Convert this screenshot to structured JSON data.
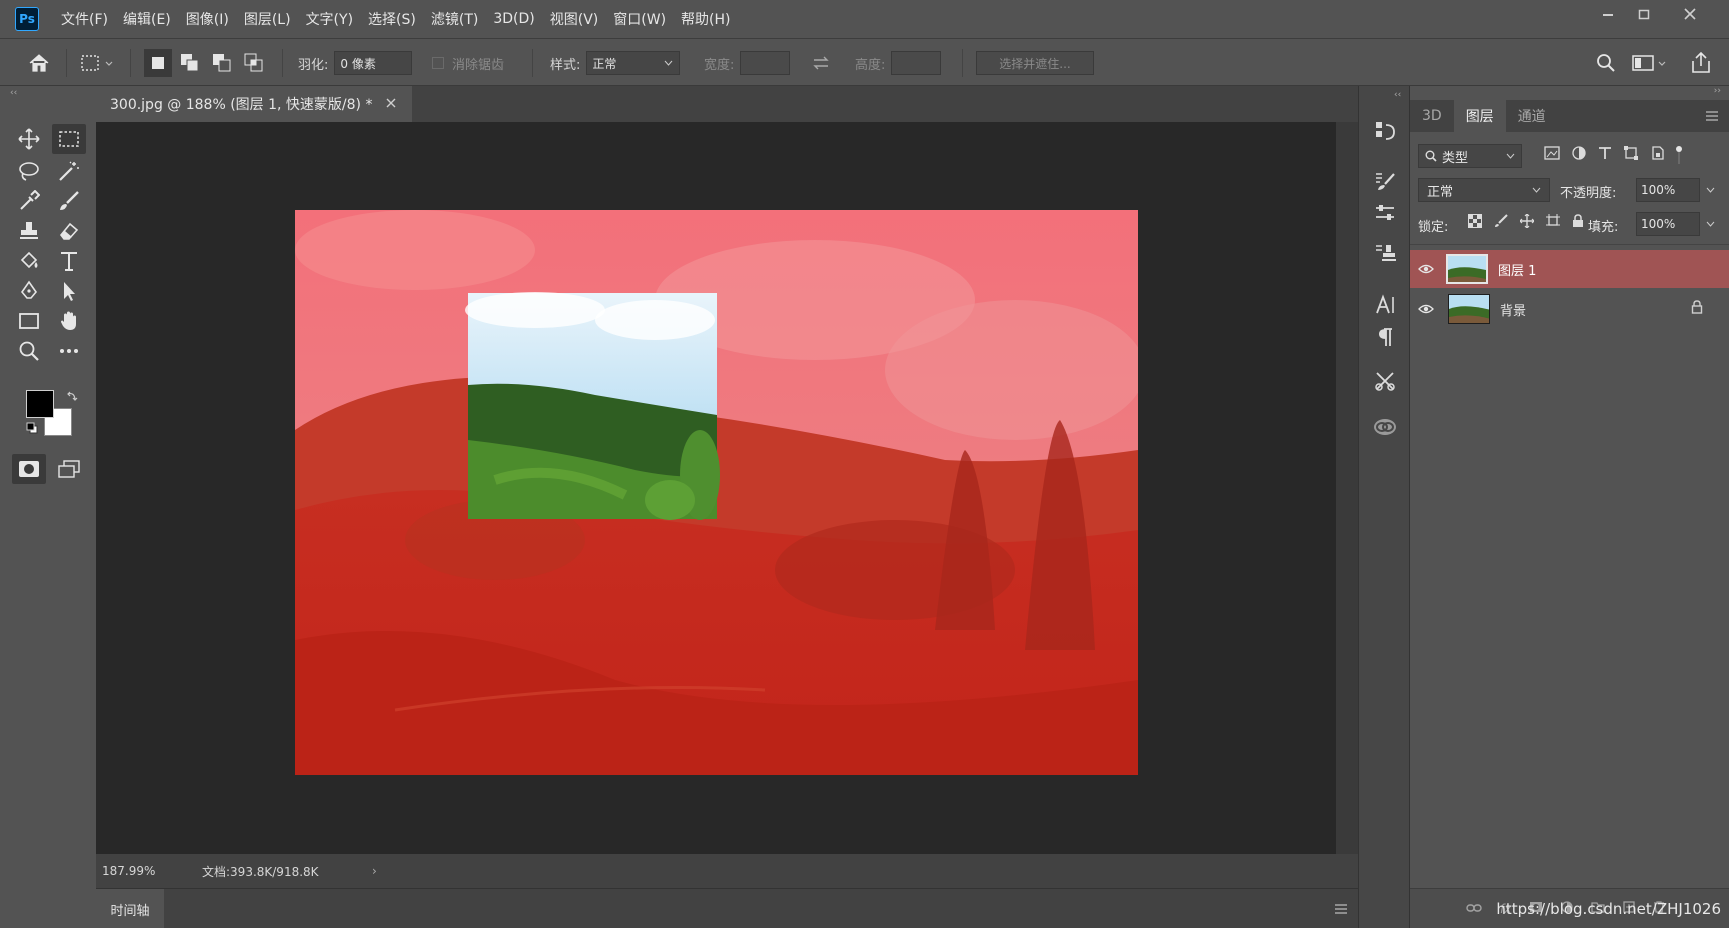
{
  "app": {
    "logo_text": "Ps"
  },
  "menu": [
    "文件(F)",
    "编辑(E)",
    "图像(I)",
    "图层(L)",
    "文字(Y)",
    "选择(S)",
    "滤镜(T)",
    "3D(D)",
    "视图(V)",
    "窗口(W)",
    "帮助(H)"
  ],
  "options": {
    "feather_label": "羽化:",
    "feather_value": "0 像素",
    "antialias_label": "消除锯齿",
    "style_label": "样式:",
    "style_value": "正常",
    "width_label": "宽度:",
    "height_label": "高度:",
    "select_mask_button": "选择并遮住..."
  },
  "document": {
    "tab_title": "300.jpg @ 188% (图层 1, 快速蒙版/8) *",
    "zoom": "187.99%",
    "doc_info": "文档:393.8K/918.8K"
  },
  "timeline": {
    "label": "时间轴"
  },
  "layers_panel": {
    "tabs": [
      "3D",
      "图层",
      "通道"
    ],
    "active_tab": "图层",
    "filter_kind": "类型",
    "blend_mode": "正常",
    "opacity_label": "不透明度:",
    "opacity_value": "100%",
    "lock_label": "锁定:",
    "fill_label": "填充:",
    "fill_value": "100%",
    "layers": [
      {
        "name": "图层 1",
        "selected": true,
        "locked": false
      },
      {
        "name": "背景",
        "selected": false,
        "locked": true
      }
    ],
    "watermark": "https://blog.csdn.net/ZHJ1026"
  },
  "colors": {
    "quick_mask_overlay": "#e0302a",
    "selected_layer": "#a05454",
    "accent": "#31a8ff"
  }
}
